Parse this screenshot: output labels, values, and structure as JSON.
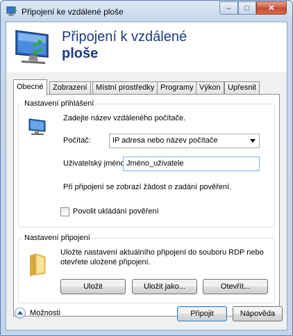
{
  "window": {
    "title": "Připojení ke vzdálené ploše",
    "controls": {
      "minimize": "–",
      "maximize": "□",
      "close": "✕"
    }
  },
  "banner": {
    "line1": "Připojení k vzdálené",
    "line2": "ploše"
  },
  "tabs": [
    {
      "label": "Obecné",
      "active": true
    },
    {
      "label": "Zobrazení",
      "active": false
    },
    {
      "label": "Místní prostředky",
      "active": false
    },
    {
      "label": "Programy",
      "active": false
    },
    {
      "label": "Výkon",
      "active": false
    },
    {
      "label": "Upřesnit",
      "active": false
    }
  ],
  "login_group": {
    "title": "Nastavení přihlášení",
    "instruction": "Zadejte název vzdáleného počítače.",
    "computer_label": "Počítač:",
    "computer_value": "IP adresa nebo název počítače",
    "user_label": "Uživatelský jméno:",
    "user_value": "Jméno_uživatele",
    "prompt_note": "Při připojení se zobrazí žádost o zadání pověření.",
    "allow_save_label": "Povolit ukládání pověření",
    "allow_save_checked": false
  },
  "connection_group": {
    "title": "Nastavení připojení",
    "description_line1": "Uložte nastavení aktuálního připojení do souboru RDP nebo",
    "description_line2": "otevřete uložené připojení.",
    "save_label": "Uložit",
    "save_as_label": "Uložit jako...",
    "open_label": "Otevřít..."
  },
  "footer": {
    "options_label": "Možnosti",
    "connect_label": "Připojit",
    "help_label": "Nápověda"
  },
  "colors": {
    "banner_text": "#1b3a80",
    "frame": "#c3d5ea",
    "close": "#c74d33"
  }
}
